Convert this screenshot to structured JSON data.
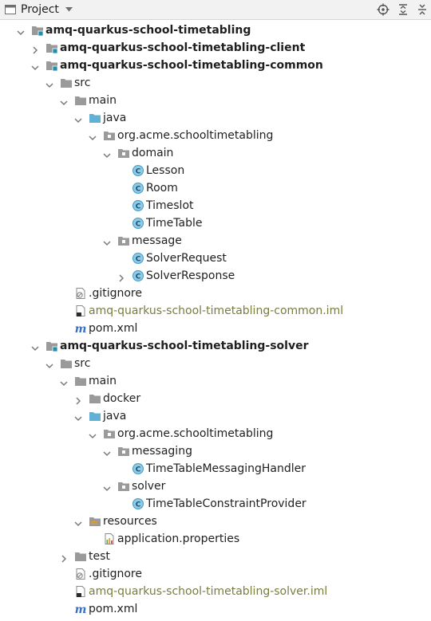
{
  "toolbar": {
    "title": "Project"
  },
  "tree": [
    {
      "label": "amq-quarkus-school-timetabling",
      "depth": 0,
      "arrow": "open",
      "icon": "module-folder",
      "bold": true
    },
    {
      "label": "amq-quarkus-school-timetabling-client",
      "depth": 1,
      "arrow": "closed",
      "icon": "module-folder",
      "bold": true
    },
    {
      "label": "amq-quarkus-school-timetabling-common",
      "depth": 1,
      "arrow": "open",
      "icon": "module-folder",
      "bold": true
    },
    {
      "label": "src",
      "depth": 2,
      "arrow": "open",
      "icon": "folder"
    },
    {
      "label": "main",
      "depth": 3,
      "arrow": "open",
      "icon": "folder"
    },
    {
      "label": "java",
      "depth": 4,
      "arrow": "open",
      "icon": "source-folder"
    },
    {
      "label": "org.acme.schooltimetabling",
      "depth": 5,
      "arrow": "open",
      "icon": "package"
    },
    {
      "label": "domain",
      "depth": 6,
      "arrow": "open",
      "icon": "package"
    },
    {
      "label": "Lesson",
      "depth": 7,
      "arrow": "none",
      "icon": "class"
    },
    {
      "label": "Room",
      "depth": 7,
      "arrow": "none",
      "icon": "class"
    },
    {
      "label": "Timeslot",
      "depth": 7,
      "arrow": "none",
      "icon": "class"
    },
    {
      "label": "TimeTable",
      "depth": 7,
      "arrow": "none",
      "icon": "class"
    },
    {
      "label": "message",
      "depth": 6,
      "arrow": "open",
      "icon": "package"
    },
    {
      "label": "SolverRequest",
      "depth": 7,
      "arrow": "none",
      "icon": "class"
    },
    {
      "label": "SolverResponse",
      "depth": 7,
      "arrow": "closed",
      "icon": "class"
    },
    {
      "label": ".gitignore",
      "depth": 3,
      "arrow": "none",
      "icon": "gitignore"
    },
    {
      "label": "amq-quarkus-school-timetabling-common.iml",
      "depth": 3,
      "arrow": "none",
      "icon": "iml",
      "olive": true
    },
    {
      "label": "pom.xml",
      "depth": 3,
      "arrow": "none",
      "icon": "maven"
    },
    {
      "label": "amq-quarkus-school-timetabling-solver",
      "depth": 1,
      "arrow": "open",
      "icon": "module-folder",
      "bold": true
    },
    {
      "label": "src",
      "depth": 2,
      "arrow": "open",
      "icon": "folder"
    },
    {
      "label": "main",
      "depth": 3,
      "arrow": "open",
      "icon": "folder"
    },
    {
      "label": "docker",
      "depth": 4,
      "arrow": "closed",
      "icon": "folder"
    },
    {
      "label": "java",
      "depth": 4,
      "arrow": "open",
      "icon": "source-folder"
    },
    {
      "label": "org.acme.schooltimetabling",
      "depth": 5,
      "arrow": "open",
      "icon": "package"
    },
    {
      "label": "messaging",
      "depth": 6,
      "arrow": "open",
      "icon": "package"
    },
    {
      "label": "TimeTableMessagingHandler",
      "depth": 7,
      "arrow": "none",
      "icon": "class"
    },
    {
      "label": "solver",
      "depth": 6,
      "arrow": "open",
      "icon": "package"
    },
    {
      "label": "TimeTableConstraintProvider",
      "depth": 7,
      "arrow": "none",
      "icon": "class"
    },
    {
      "label": "resources",
      "depth": 4,
      "arrow": "open",
      "icon": "resources-folder"
    },
    {
      "label": "application.properties",
      "depth": 5,
      "arrow": "none",
      "icon": "properties"
    },
    {
      "label": "test",
      "depth": 3,
      "arrow": "closed",
      "icon": "folder"
    },
    {
      "label": ".gitignore",
      "depth": 3,
      "arrow": "none",
      "icon": "gitignore"
    },
    {
      "label": "amq-quarkus-school-timetabling-solver.iml",
      "depth": 3,
      "arrow": "none",
      "icon": "iml",
      "olive": true
    },
    {
      "label": "pom.xml",
      "depth": 3,
      "arrow": "none",
      "icon": "maven"
    }
  ]
}
